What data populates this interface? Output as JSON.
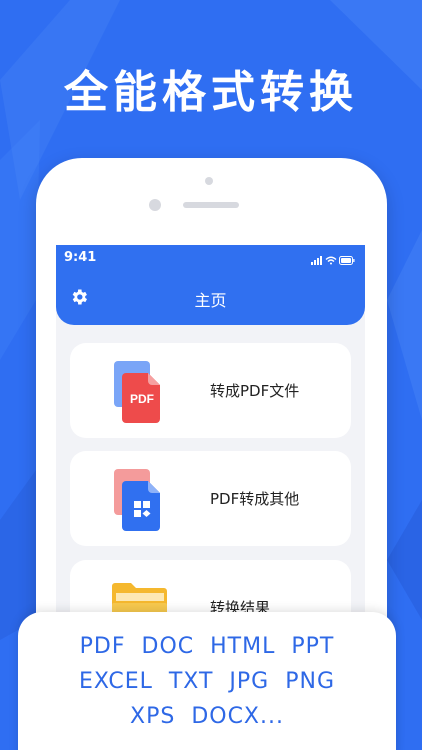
{
  "headline": "全能格式转换",
  "status_bar": {
    "time": "9:41"
  },
  "header": {
    "title": "主页",
    "settings_icon": "gear-icon"
  },
  "cards": [
    {
      "label": "转成PDF文件",
      "icon": "pdf-file-icon",
      "badge": "PDF"
    },
    {
      "label": "PDF转成其他",
      "icon": "convert-file-icon"
    },
    {
      "label": "转换结果",
      "icon": "folder-icon"
    }
  ],
  "formats": {
    "row1": [
      "PDF",
      "DOC",
      "HTML",
      "PPT"
    ],
    "row2": [
      "EXCEL",
      "TXT",
      "JPG",
      "PNG"
    ],
    "row3": [
      "XPS",
      "DOCX..."
    ]
  },
  "colors": {
    "brand_blue": "#2f6ef2",
    "header_blue": "#3070f0",
    "pdf_red": "#ee4b4b",
    "folder_yellow": "#f5b82e"
  }
}
